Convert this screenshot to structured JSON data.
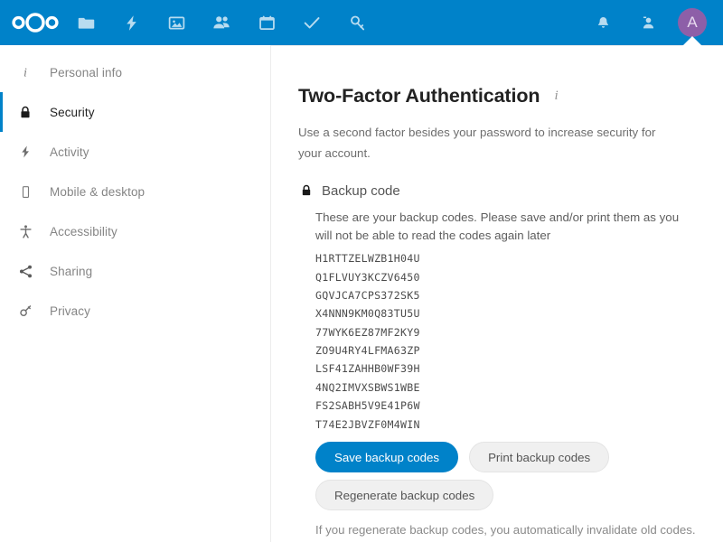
{
  "theme": {
    "header_bg": "#0082c9",
    "primary": "#0082c9",
    "avatar_bg": "#8d5fa8",
    "text_dark": "#222222",
    "text_muted": "#858585"
  },
  "header": {
    "logo_name": "nextcloud-logo",
    "apps": [
      {
        "name": "files-icon",
        "label": "Files"
      },
      {
        "name": "activity-icon",
        "label": "Activity"
      },
      {
        "name": "photos-icon",
        "label": "Photos"
      },
      {
        "name": "contacts-icon",
        "label": "Contacts"
      },
      {
        "name": "calendar-icon",
        "label": "Calendar"
      },
      {
        "name": "tasks-icon",
        "label": "Tasks"
      },
      {
        "name": "passwords-icon",
        "label": "Passwords"
      }
    ],
    "right": [
      {
        "name": "notifications-icon",
        "label": "Notifications"
      },
      {
        "name": "contacts-menu-icon",
        "label": "Contacts"
      }
    ],
    "avatar": {
      "initial": "A",
      "label": "Settings menu"
    }
  },
  "sidebar": {
    "items": [
      {
        "label": "Personal info",
        "icon": "info-icon",
        "active": false
      },
      {
        "label": "Security",
        "icon": "lock-icon",
        "active": true
      },
      {
        "label": "Activity",
        "icon": "lightning-icon",
        "active": false
      },
      {
        "label": "Mobile & desktop",
        "icon": "mobile-icon",
        "active": false
      },
      {
        "label": "Accessibility",
        "icon": "accessibility-icon",
        "active": false
      },
      {
        "label": "Sharing",
        "icon": "share-icon",
        "active": false
      },
      {
        "label": "Privacy",
        "icon": "key-icon",
        "active": false
      }
    ]
  },
  "main": {
    "title": "Two-Factor Authentication",
    "title_info_icon": "info-icon",
    "description": "Use a second factor besides your password to increase security for your account.",
    "provider": {
      "icon": "lock-icon",
      "name": "Backup code",
      "intro": "These are your backup codes. Please save and/or print them as you will not be able to read the codes again later",
      "codes": [
        "H1RTTZELWZB1H04U",
        "Q1FLVUY3KCZV6450",
        "GQVJCA7CPS372SK5",
        "X4NNN9KM0Q83TU5U",
        "77WYK6EZ87MF2KY9",
        "ZO9U4RY4LFMA63ZP",
        "LSF41ZAHHB0WF39H",
        "4NQ2IMVXSBWS1WBE",
        "FS2SABH5V9E41P6W",
        "T74E2JBVZF0M4WIN"
      ],
      "save_label": "Save backup codes",
      "print_label": "Print backup codes",
      "regenerate_label": "Regenerate backup codes",
      "regenerate_note": "If you regenerate backup codes, you automatically invalidate old codes."
    }
  }
}
